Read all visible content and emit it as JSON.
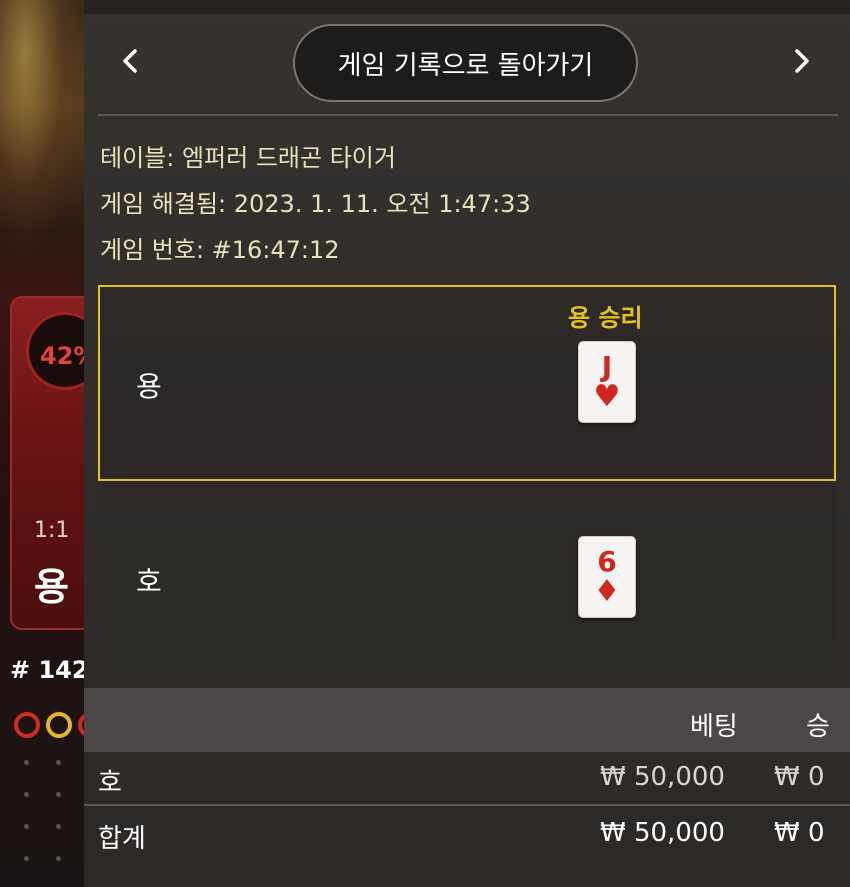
{
  "background": {
    "dragon_percent": "42%",
    "odds": "1:1",
    "dragon_label": "용",
    "round_number": "# 142"
  },
  "modal": {
    "back_button_label": "게임 기록으로 돌아가기",
    "prev_icon": "chevron-left",
    "next_icon": "chevron-right",
    "table_line": "테이블: 엠퍼러 드래곤 타이거",
    "resolved_line": "게임 해결됨: 2023. 1. 11. 오전 1:47:33",
    "game_no_line": "게임 번호: #16:47:12"
  },
  "result": {
    "winner_label": "용 승리",
    "dragon": {
      "label": "용",
      "card_rank": "J",
      "card_suit": "♥",
      "is_winner": true
    },
    "tiger": {
      "label": "호",
      "card_rank": "6",
      "card_suit": "♦",
      "is_winner": false
    },
    "winner_border_color": "#e6c417",
    "card_color": "#d0261e"
  },
  "bets": {
    "header_bet": "베팅",
    "header_win": "승",
    "rows": [
      {
        "label": "호",
        "bet": "₩ 50,000",
        "win": "₩ 0"
      }
    ],
    "total": {
      "label": "합계",
      "bet": "₩ 50,000",
      "win": "₩ 0"
    }
  }
}
